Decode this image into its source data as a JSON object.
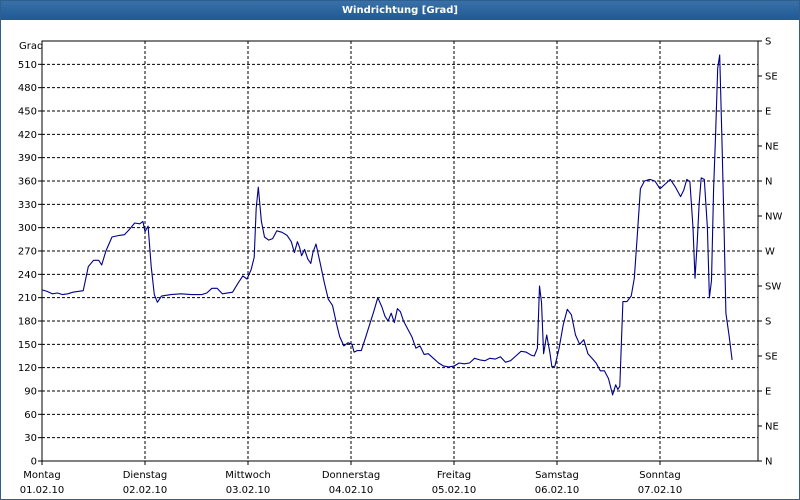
{
  "window": {
    "title": "Windrichtung [Grad]"
  },
  "chart_data": {
    "type": "line",
    "title": "Windrichtung [Grad]",
    "ylabel": "Grad",
    "ylim": [
      0,
      525
    ],
    "yticks": [
      0,
      30,
      60,
      90,
      120,
      150,
      180,
      210,
      240,
      270,
      300,
      330,
      360,
      390,
      420,
      450,
      480,
      510
    ],
    "right_axis_ticks": [
      {
        "value": 0,
        "label": "N"
      },
      {
        "value": 45,
        "label": "NE"
      },
      {
        "value": 90,
        "label": "E"
      },
      {
        "value": 135,
        "label": "SE"
      },
      {
        "value": 180,
        "label": "S"
      },
      {
        "value": 225,
        "label": "SW"
      },
      {
        "value": 270,
        "label": "W"
      },
      {
        "value": 315,
        "label": "NW"
      },
      {
        "value": 360,
        "label": "N"
      },
      {
        "value": 405,
        "label": "NE"
      },
      {
        "value": 450,
        "label": "E"
      },
      {
        "value": 495,
        "label": "SE"
      },
      {
        "value": 540,
        "label": "S"
      }
    ],
    "xlim": [
      0,
      7
    ],
    "x_ticks": [
      {
        "day": "Montag",
        "date": "01.02.10"
      },
      {
        "day": "Dienstag",
        "date": "02.02.10"
      },
      {
        "day": "Mittwoch",
        "date": "03.02.10"
      },
      {
        "day": "Donnerstag",
        "date": "04.02.10"
      },
      {
        "day": "Freitag",
        "date": "05.02.10"
      },
      {
        "day": "Samstag",
        "date": "06.02.10"
      },
      {
        "day": "Sonntag",
        "date": "07.02.10"
      }
    ],
    "grid": true,
    "series": [
      {
        "color": "#00008b",
        "points": [
          [
            0.0,
            220
          ],
          [
            0.05,
            218
          ],
          [
            0.1,
            215
          ],
          [
            0.15,
            216
          ],
          [
            0.2,
            214
          ],
          [
            0.25,
            215
          ],
          [
            0.3,
            217
          ],
          [
            0.35,
            218
          ],
          [
            0.4,
            219
          ],
          [
            0.45,
            250
          ],
          [
            0.5,
            258
          ],
          [
            0.55,
            258
          ],
          [
            0.58,
            252
          ],
          [
            0.62,
            270
          ],
          [
            0.68,
            288
          ],
          [
            0.75,
            290
          ],
          [
            0.8,
            291
          ],
          [
            0.85,
            298
          ],
          [
            0.9,
            306
          ],
          [
            0.95,
            305
          ],
          [
            0.98,
            308
          ],
          [
            1.0,
            295
          ],
          [
            1.03,
            302
          ],
          [
            1.06,
            250
          ],
          [
            1.09,
            214
          ],
          [
            1.12,
            204
          ],
          [
            1.16,
            212
          ],
          [
            1.25,
            214
          ],
          [
            1.35,
            215
          ],
          [
            1.45,
            214
          ],
          [
            1.55,
            214
          ],
          [
            1.6,
            216
          ],
          [
            1.65,
            222
          ],
          [
            1.7,
            222
          ],
          [
            1.75,
            215
          ],
          [
            1.85,
            217
          ],
          [
            1.9,
            228
          ],
          [
            1.95,
            238
          ],
          [
            1.99,
            234
          ],
          [
            2.03,
            246
          ],
          [
            2.06,
            262
          ],
          [
            2.08,
            325
          ],
          [
            2.1,
            352
          ],
          [
            2.13,
            308
          ],
          [
            2.16,
            288
          ],
          [
            2.2,
            284
          ],
          [
            2.24,
            286
          ],
          [
            2.28,
            296
          ],
          [
            2.33,
            294
          ],
          [
            2.38,
            290
          ],
          [
            2.42,
            282
          ],
          [
            2.45,
            268
          ],
          [
            2.48,
            282
          ],
          [
            2.5,
            275
          ],
          [
            2.52,
            264
          ],
          [
            2.55,
            272
          ],
          [
            2.58,
            260
          ],
          [
            2.61,
            254
          ],
          [
            2.63,
            268
          ],
          [
            2.66,
            279
          ],
          [
            2.7,
            255
          ],
          [
            2.74,
            230
          ],
          [
            2.78,
            208
          ],
          [
            2.82,
            200
          ],
          [
            2.86,
            176
          ],
          [
            2.89,
            160
          ],
          [
            2.93,
            148
          ],
          [
            2.97,
            152
          ],
          [
            3.01,
            150
          ],
          [
            3.03,
            140
          ],
          [
            3.06,
            142
          ],
          [
            3.1,
            142
          ],
          [
            3.14,
            158
          ],
          [
            3.18,
            175
          ],
          [
            3.22,
            192
          ],
          [
            3.26,
            210
          ],
          [
            3.3,
            198
          ],
          [
            3.33,
            186
          ],
          [
            3.36,
            180
          ],
          [
            3.39,
            190
          ],
          [
            3.42,
            178
          ],
          [
            3.45,
            196
          ],
          [
            3.48,
            192
          ],
          [
            3.51,
            180
          ],
          [
            3.55,
            170
          ],
          [
            3.59,
            160
          ],
          [
            3.63,
            145
          ],
          [
            3.67,
            148
          ],
          [
            3.71,
            137
          ],
          [
            3.75,
            138
          ],
          [
            3.8,
            132
          ],
          [
            3.85,
            126
          ],
          [
            3.9,
            122
          ],
          [
            3.95,
            121
          ],
          [
            4.0,
            122
          ],
          [
            4.05,
            126
          ],
          [
            4.1,
            125
          ],
          [
            4.15,
            126
          ],
          [
            4.2,
            132
          ],
          [
            4.25,
            130
          ],
          [
            4.3,
            129
          ],
          [
            4.35,
            132
          ],
          [
            4.4,
            131
          ],
          [
            4.45,
            134
          ],
          [
            4.5,
            127
          ],
          [
            4.55,
            129
          ],
          [
            4.6,
            135
          ],
          [
            4.65,
            141
          ],
          [
            4.7,
            140
          ],
          [
            4.75,
            136
          ],
          [
            4.78,
            135
          ],
          [
            4.81,
            145
          ],
          [
            4.83,
            225
          ],
          [
            4.85,
            204
          ],
          [
            4.87,
            138
          ],
          [
            4.9,
            162
          ],
          [
            4.93,
            140
          ],
          [
            4.95,
            121
          ],
          [
            4.98,
            122
          ],
          [
            5.02,
            145
          ],
          [
            5.06,
            175
          ],
          [
            5.1,
            195
          ],
          [
            5.14,
            188
          ],
          [
            5.18,
            162
          ],
          [
            5.22,
            150
          ],
          [
            5.26,
            156
          ],
          [
            5.3,
            138
          ],
          [
            5.34,
            132
          ],
          [
            5.38,
            126
          ],
          [
            5.42,
            116
          ],
          [
            5.46,
            116
          ],
          [
            5.5,
            106
          ],
          [
            5.54,
            85
          ],
          [
            5.57,
            98
          ],
          [
            5.59,
            92
          ],
          [
            5.61,
            96
          ],
          [
            5.64,
            205
          ],
          [
            5.68,
            205
          ],
          [
            5.72,
            212
          ],
          [
            5.75,
            235
          ],
          [
            5.78,
            290
          ],
          [
            5.81,
            350
          ],
          [
            5.85,
            360
          ],
          [
            5.9,
            362
          ],
          [
            5.95,
            360
          ],
          [
            6.0,
            350
          ],
          [
            6.05,
            356
          ],
          [
            6.1,
            362
          ],
          [
            6.15,
            352
          ],
          [
            6.2,
            340
          ],
          [
            6.23,
            348
          ],
          [
            6.26,
            362
          ],
          [
            6.29,
            359
          ],
          [
            6.32,
            300
          ],
          [
            6.34,
            235
          ],
          [
            6.36,
            278
          ],
          [
            6.38,
            330
          ],
          [
            6.4,
            364
          ],
          [
            6.43,
            362
          ],
          [
            6.46,
            300
          ],
          [
            6.48,
            210
          ],
          [
            6.5,
            232
          ],
          [
            6.52,
            350
          ],
          [
            6.54,
            420
          ],
          [
            6.56,
            505
          ],
          [
            6.58,
            522
          ],
          [
            6.6,
            420
          ],
          [
            6.62,
            310
          ],
          [
            6.64,
            190
          ],
          [
            6.67,
            162
          ],
          [
            6.7,
            130
          ]
        ]
      }
    ]
  }
}
